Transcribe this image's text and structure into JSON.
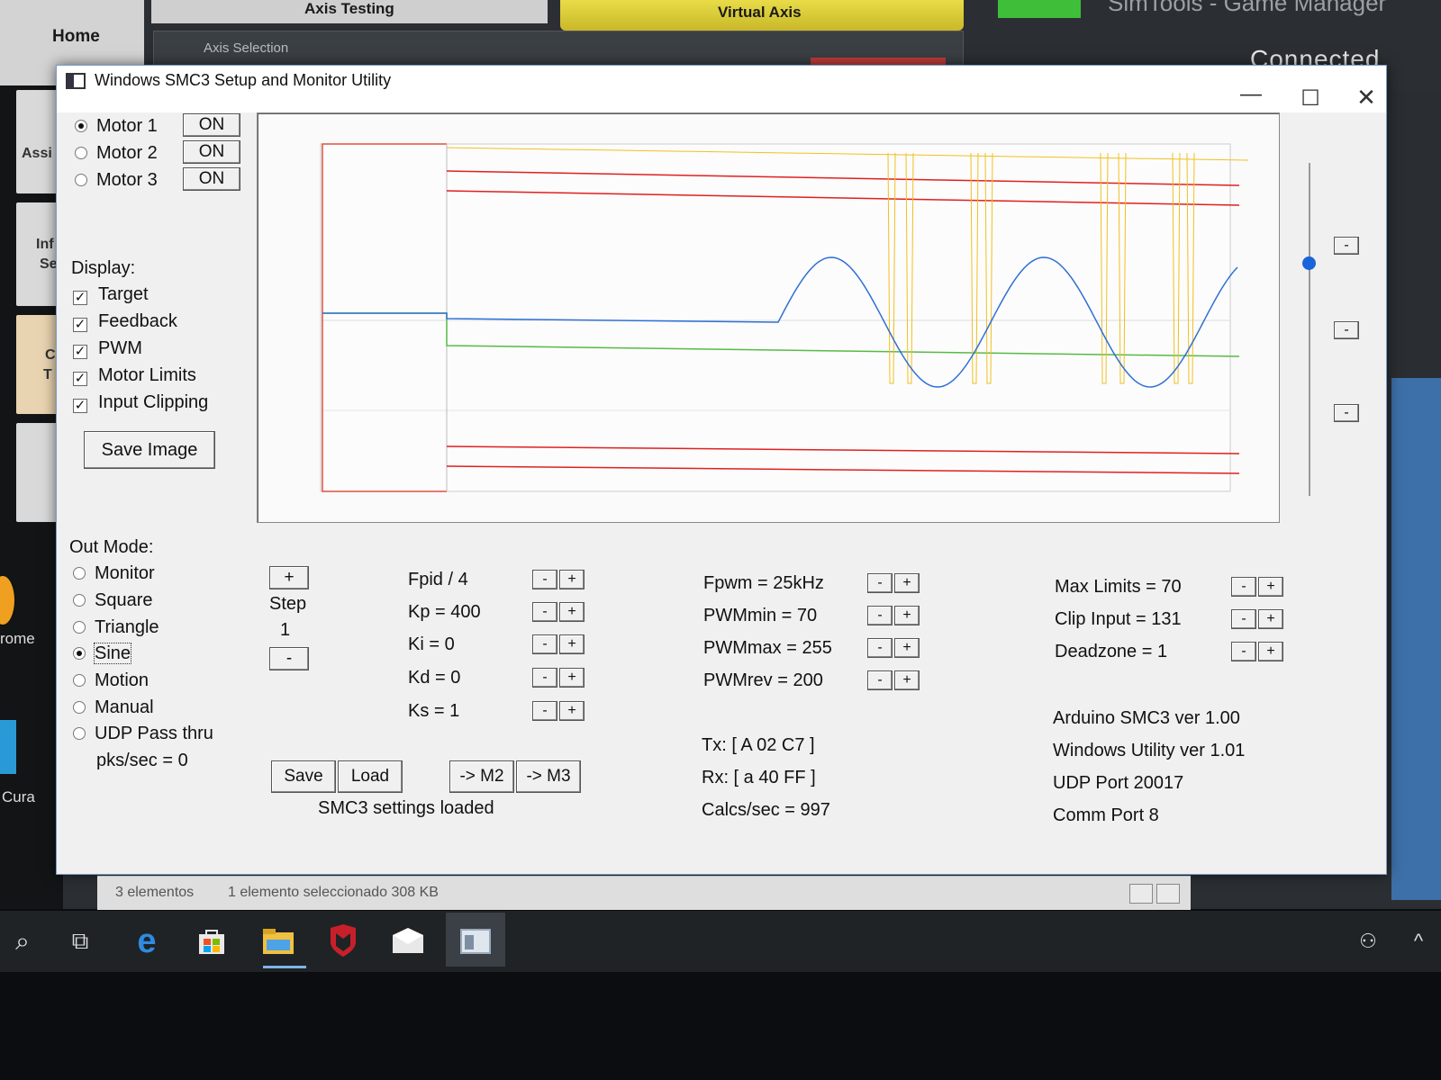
{
  "background_app": {
    "home_label": "Home",
    "tab_axis_testing": "Axis Testing",
    "tab_virtual_axis": "Virtual Axis",
    "axis_selection": "Axis Selection",
    "title": "SimTools - Game Manager",
    "connected": "Connected",
    "left_labels": [
      "Assi",
      "Inf",
      "Se",
      "C",
      "T"
    ],
    "chrome_label": "rome",
    "cura_label": "Cura"
  },
  "window": {
    "title": "Windows SMC3 Setup and Monitor Utility",
    "min": "—",
    "max": "☐",
    "close": "✕"
  },
  "motors": [
    {
      "label": "Motor 1",
      "selected": true,
      "button": "ON"
    },
    {
      "label": "Motor 2",
      "selected": false,
      "button": "ON"
    },
    {
      "label": "Motor 3",
      "selected": false,
      "button": "ON"
    }
  ],
  "display": {
    "header": "Display:",
    "items": [
      "Target",
      "Feedback",
      "PWM",
      "Motor Limits",
      "Input Clipping"
    ],
    "save_image": "Save Image"
  },
  "out_mode": {
    "header": "Out Mode:",
    "options": [
      {
        "label": "Monitor",
        "selected": false
      },
      {
        "label": "Square",
        "selected": false
      },
      {
        "label": "Triangle",
        "selected": false
      },
      {
        "label": "Sine",
        "selected": true
      },
      {
        "label": "Motion",
        "selected": false
      },
      {
        "label": "Manual",
        "selected": false
      },
      {
        "label": "UDP Pass thru",
        "selected": false
      }
    ],
    "pks": "pks/sec = 0"
  },
  "step": {
    "plus": "+",
    "label": "Step",
    "value": "1",
    "minus": "-"
  },
  "pid": [
    "Fpid / 4",
    "Kp = 400",
    "Ki = 0",
    "Kd = 0",
    "Ks = 1"
  ],
  "pwm": [
    "Fpwm = 25kHz",
    "PWMmin = 70",
    "PWMmax = 255",
    "PWMrev = 200"
  ],
  "limits": [
    "Max Limits = 70",
    "Clip Input = 131",
    "Deadzone = 1"
  ],
  "buttons": {
    "save": "Save",
    "load": "Load",
    "to_m2": "-> M2",
    "to_m3": "-> M3",
    "minus": "-",
    "plus": "+"
  },
  "status_msg": "SMC3 settings loaded",
  "comm": {
    "tx": "Tx: [ A 02 C7 ]",
    "rx": "Rx: [ a 40 FF ]",
    "calcs": "Calcs/sec = 997"
  },
  "versions": [
    "Arduino SMC3 ver 1.00",
    "Windows Utility ver 1.01",
    "UDP Port 20017",
    "Comm Port 8"
  ],
  "explorer_status": {
    "items": "3 elementos",
    "selected": "1 elemento seleccionado  308 KB"
  },
  "colors": {
    "target": "#2f6fd6",
    "feedback": "#58b947",
    "pwm": "#f0c020",
    "limits": "#e02020",
    "clip": "#e06040"
  },
  "taskbar_icons": [
    "search-icon",
    "task-view-icon",
    "edge-icon",
    "store-icon",
    "file-explorer-icon",
    "mcafee-icon",
    "mail-icon",
    "smc3-app-icon"
  ]
}
